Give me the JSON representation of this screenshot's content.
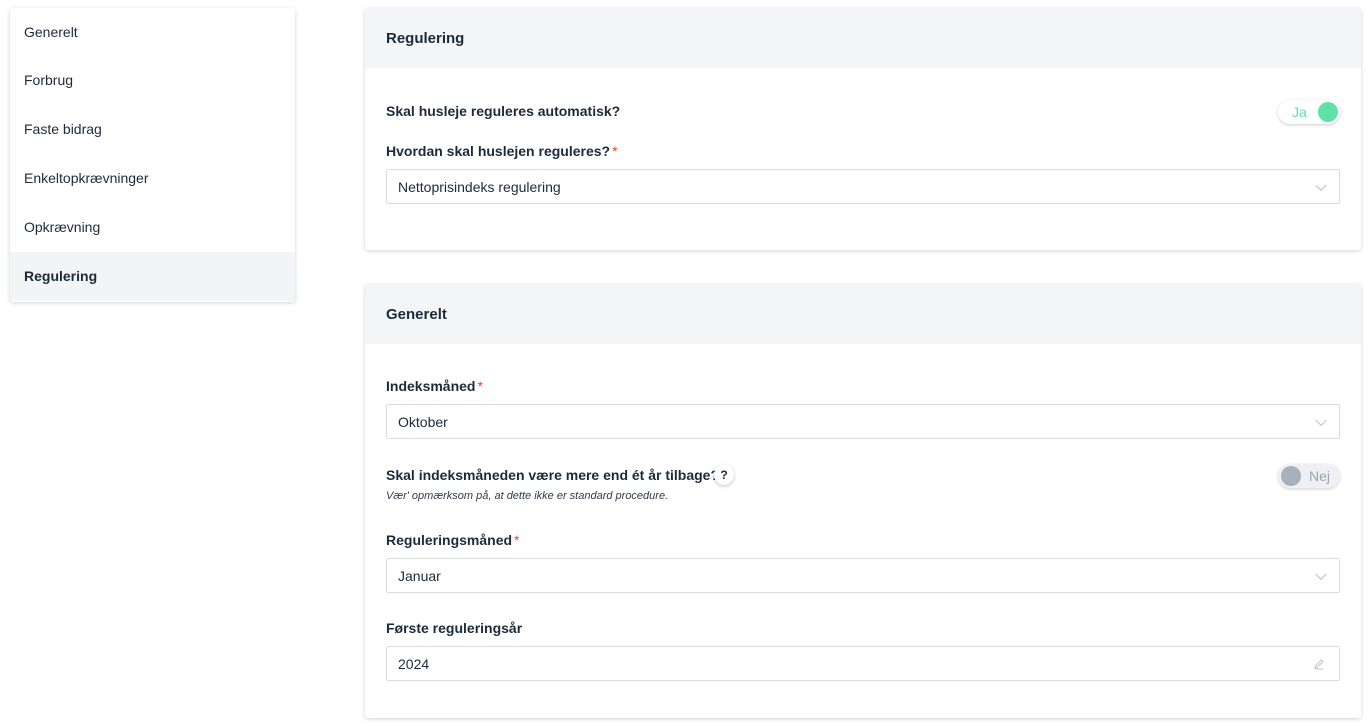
{
  "sidebar": {
    "items": [
      {
        "label": "Generelt"
      },
      {
        "label": "Forbrug"
      },
      {
        "label": "Faste bidrag"
      },
      {
        "label": "Enkeltopkrævninger"
      },
      {
        "label": "Opkrævning"
      },
      {
        "label": "Regulering"
      }
    ],
    "active": "Regulering"
  },
  "regulering_card": {
    "title": "Regulering",
    "auto_question": "Skal husleje reguleres automatisk?",
    "auto_toggle": {
      "label": "Ja",
      "state": "on"
    },
    "method_label": "Hvordan skal huslejen reguleres?",
    "method_required": "*",
    "method_value": "Nettoprisindeks regulering"
  },
  "generelt_card": {
    "title": "Generelt",
    "index_month_label": "Indeksmåned",
    "index_month_required": "*",
    "index_month_value": "Oktober",
    "back_question": "Skal indeksmåneden være mere end ét år tilbage?",
    "help_symbol": "?",
    "back_hint": "Vær' opmærksom på, at dette ikke er standard procedure.",
    "back_toggle": {
      "label": "Nej",
      "state": "off"
    },
    "reg_month_label": "Reguleringsmåned",
    "reg_month_required": "*",
    "reg_month_value": "Januar",
    "first_year_label": "Første reguleringsår",
    "first_year_value": "2024"
  },
  "colors": {
    "accent_green": "#5fe0a6",
    "required_red": "#e0463a",
    "header_bg": "#f4f5f7",
    "text": "#1c2b3a"
  },
  "icons": {
    "select_arrow": "chevron-down-icon",
    "year_field": "pencil-icon",
    "help": "question-icon"
  }
}
